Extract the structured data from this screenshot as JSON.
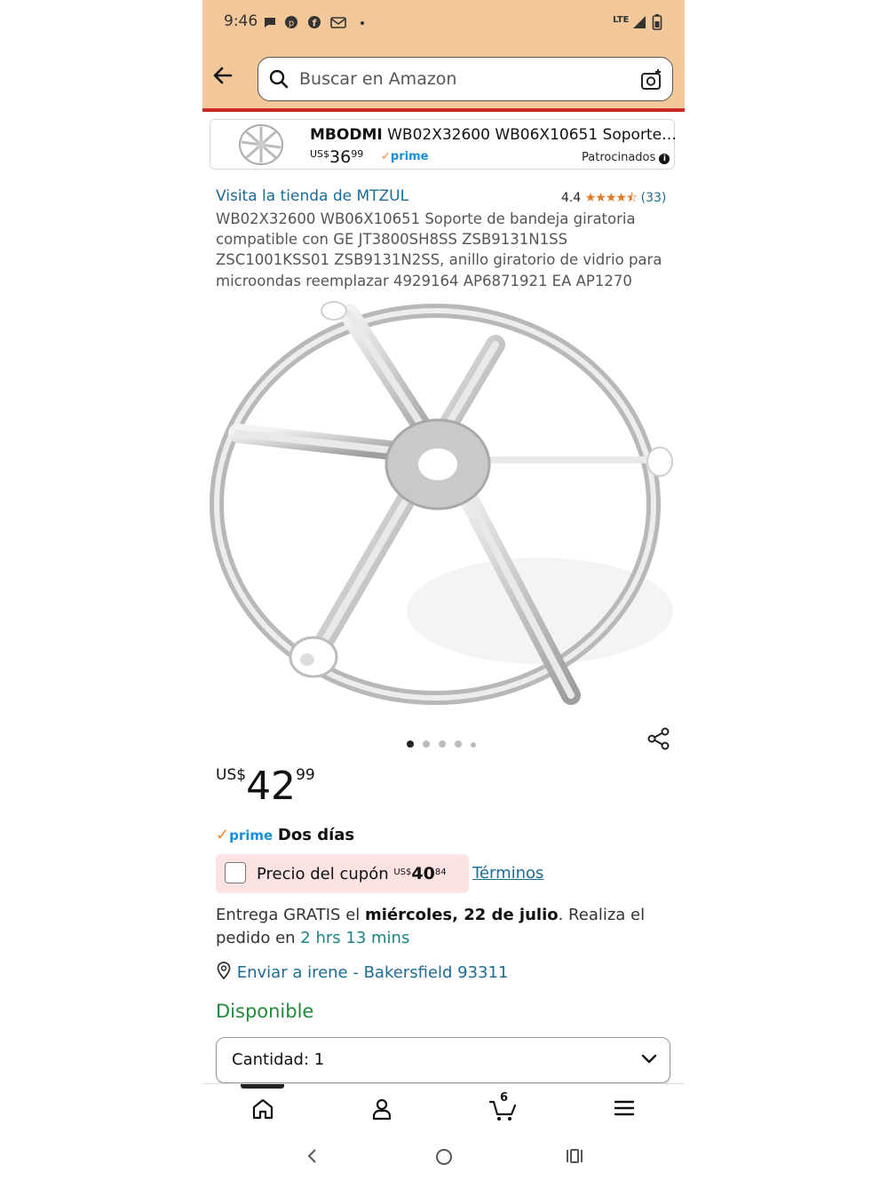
{
  "status_bar": {
    "time": "9:46",
    "network": "LTE"
  },
  "search": {
    "placeholder": "Buscar en Amazon"
  },
  "sponsored": {
    "brand": "MBODMI",
    "title": " WB02X32600 WB06X10651 Soporte…",
    "price_currency": "US$",
    "price_whole": "36",
    "price_cents": "99",
    "prime": "prime",
    "label": "Patrocinados"
  },
  "product": {
    "store_link": "Visita la tienda de MTZUL",
    "rating": "4.4",
    "stars": "★★★★⯪",
    "review_count": "(33)",
    "title": "WB02X32600 WB06X10651 Soporte de bandeja giratoria compatible con GE JT3800SH8SS ZSB9131N1SS ZSC1001KSS01 ZSB9131N2SS, anillo giratorio de vidrio para microondas reemplazar 4929164 AP6871921 EA AP1270",
    "image_count": 5,
    "image_index": 1
  },
  "price": {
    "currency": "US$",
    "whole": "42",
    "cents": "99"
  },
  "prime_delivery": {
    "prime": "prime",
    "text": "Dos días"
  },
  "coupon": {
    "label": "Precio del cupón ",
    "currency": "US$",
    "whole": "40",
    "cents": "84",
    "terms": "Términos"
  },
  "delivery": {
    "prefix": "Entrega GRATIS el ",
    "date": "miércoles, 22 de julio",
    "middle": ". Realiza el pedido en ",
    "countdown": "2 hrs 13 mins"
  },
  "ship_to": "Enviar a irene - Bakersfield 93311",
  "availability": "Disponible",
  "quantity": "Cantidad: 1",
  "cart_count": "6",
  "colors": {
    "header": "#f2c89a",
    "link": "#1b6b99",
    "prime": "#1a8fd6",
    "in_stock": "#218a3a",
    "coupon_bg": "#fbe3e3"
  }
}
